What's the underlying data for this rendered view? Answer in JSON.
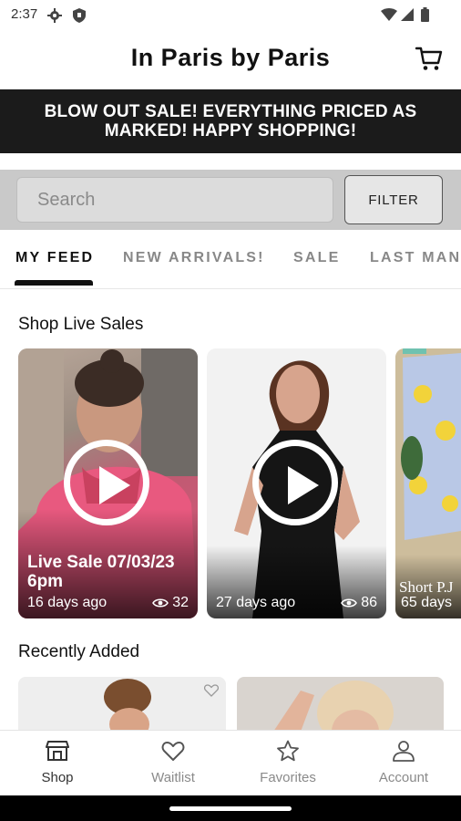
{
  "status": {
    "time": "2:37"
  },
  "header": {
    "title": "In Paris by Paris"
  },
  "banner": {
    "text": "BLOW OUT SALE! EVERYTHING PRICED AS MARKED! HAPPY SHOPPING!"
  },
  "search": {
    "placeholder": "Search",
    "filter_label": "FILTER"
  },
  "tabs": [
    "MY FEED",
    "NEW ARRIVALS!",
    "SALE",
    "LAST MAN"
  ],
  "live": {
    "title": "Shop Live Sales",
    "cards": [
      {
        "title": "Live Sale 07/03/23 6pm",
        "ago": "16 days ago",
        "views": "32"
      },
      {
        "title": "",
        "ago": "27 days ago",
        "views": "86"
      },
      {
        "title": "Short P.J",
        "ago": "65 days"
      }
    ]
  },
  "recent": {
    "title": "Recently Added"
  },
  "nav": [
    {
      "label": "Shop",
      "icon": "shop-icon"
    },
    {
      "label": "Waitlist",
      "icon": "heart-icon"
    },
    {
      "label": "Favorites",
      "icon": "star-icon"
    },
    {
      "label": "Account",
      "icon": "account-icon"
    }
  ],
  "colors": {
    "banner": "#1b1b1b",
    "searchbar": "#c9c9c9",
    "active_tab": "#111111"
  }
}
